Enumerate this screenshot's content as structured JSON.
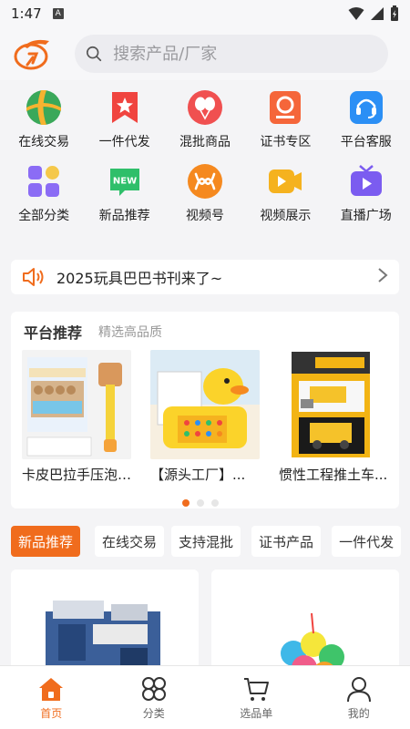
{
  "status": {
    "time": "1:47",
    "badge": "A"
  },
  "search": {
    "placeholder": "搜索产品/厂家"
  },
  "categories": [
    {
      "label": "在线交易",
      "icon": "globe-icon"
    },
    {
      "label": "一件代发",
      "icon": "bookmark-star-icon"
    },
    {
      "label": "混批商品",
      "icon": "balloons-icon"
    },
    {
      "label": "证书专区",
      "icon": "certificate-icon"
    },
    {
      "label": "平台客服",
      "icon": "headset-icon"
    },
    {
      "label": "全部分类",
      "icon": "grid-icon"
    },
    {
      "label": "新品推荐",
      "icon": "new-badge-icon"
    },
    {
      "label": "视频号",
      "icon": "video-channel-icon"
    },
    {
      "label": "视频展示",
      "icon": "video-play-icon"
    },
    {
      "label": "直播广场",
      "icon": "live-tv-icon"
    }
  ],
  "notice": {
    "text": "2025玩具巴巴书刊来了~"
  },
  "recommend": {
    "title": "平台推荐",
    "subtitle": "精选高品质",
    "products": [
      {
        "name": "卡皮巴拉手压泡泡枪..."
      },
      {
        "name": "【源头工厂】..."
      },
      {
        "name": "惯性工程推土车..."
      }
    ]
  },
  "tabs": [
    "新品推荐",
    "在线交易",
    "支持混批",
    "证书产品",
    "一件代发"
  ],
  "nav": [
    {
      "label": "首页",
      "icon": "home-icon"
    },
    {
      "label": "分类",
      "icon": "category-icon"
    },
    {
      "label": "选品单",
      "icon": "cart-icon"
    },
    {
      "label": "我的",
      "icon": "user-icon"
    }
  ],
  "colors": {
    "accent": "#f06c1d"
  }
}
